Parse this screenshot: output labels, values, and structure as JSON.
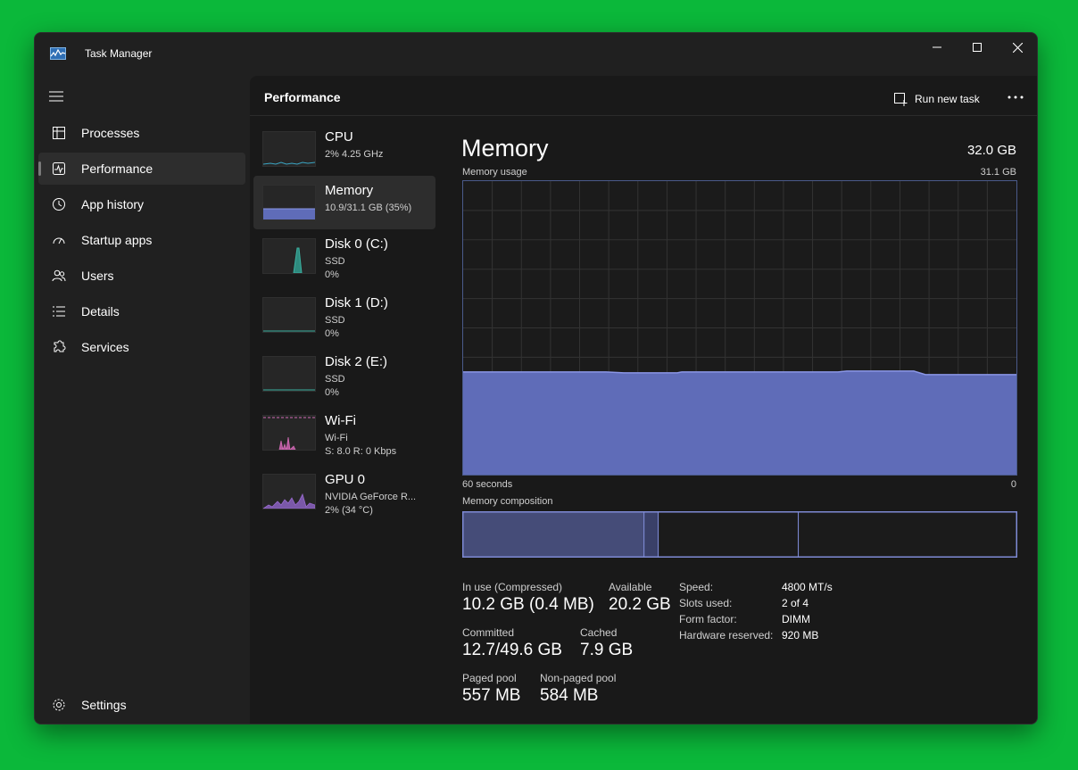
{
  "window": {
    "title": "Task Manager",
    "icon": "task-manager-icon"
  },
  "nav": {
    "items": [
      {
        "label": "Processes",
        "icon": "processes-icon",
        "active": false
      },
      {
        "label": "Performance",
        "icon": "performance-icon",
        "active": true
      },
      {
        "label": "App history",
        "icon": "app-history-icon",
        "active": false
      },
      {
        "label": "Startup apps",
        "icon": "startup-apps-icon",
        "active": false
      },
      {
        "label": "Users",
        "icon": "users-icon",
        "active": false
      },
      {
        "label": "Details",
        "icon": "details-icon",
        "active": false
      },
      {
        "label": "Services",
        "icon": "services-icon",
        "active": false
      }
    ],
    "settings_label": "Settings"
  },
  "header": {
    "title": "Performance",
    "run_new_task": "Run new task"
  },
  "resources": [
    {
      "name": "CPU",
      "line1": "2% 4.25 GHz",
      "line2": "",
      "color": "#3aa6c4"
    },
    {
      "name": "Memory",
      "line1": "10.9/31.1 GB (35%)",
      "line2": "",
      "color": "#6b7fd8"
    },
    {
      "name": "Disk 0 (C:)",
      "line1": "SSD",
      "line2": "0%",
      "color": "#3bb0a0"
    },
    {
      "name": "Disk 1 (D:)",
      "line1": "SSD",
      "line2": "0%",
      "color": "#3bb0a0"
    },
    {
      "name": "Disk 2 (E:)",
      "line1": "SSD",
      "line2": "0%",
      "color": "#3bb0a0"
    },
    {
      "name": "Wi-Fi",
      "line1": "Wi-Fi",
      "line2": "S: 8.0 R: 0 Kbps",
      "color": "#d06ab4"
    },
    {
      "name": "GPU 0",
      "line1": "NVIDIA GeForce R...",
      "line2": "2% (34 °C)",
      "color": "#9a6ad0"
    }
  ],
  "memory": {
    "title": "Memory",
    "total": "32.0 GB",
    "usage_label": "Memory usage",
    "usage_max": "31.1 GB",
    "time_left": "60 seconds",
    "time_right": "0",
    "composition_label": "Memory composition",
    "composition": {
      "in_use": 10.2,
      "modified": 0.4,
      "standby": 7.9,
      "free": 12.3
    },
    "usage_fraction": 0.35,
    "stats": {
      "in_use_label": "In use (Compressed)",
      "in_use_value": "10.2 GB (0.4 MB)",
      "available_label": "Available",
      "available_value": "20.2 GB",
      "committed_label": "Committed",
      "committed_value": "12.7/49.6 GB",
      "cached_label": "Cached",
      "cached_value": "7.9 GB",
      "paged_label": "Paged pool",
      "paged_value": "557 MB",
      "nonpaged_label": "Non-paged pool",
      "nonpaged_value": "584 MB"
    },
    "specs": [
      {
        "key": "Speed:",
        "value": "4800 MT/s"
      },
      {
        "key": "Slots used:",
        "value": "2 of 4"
      },
      {
        "key": "Form factor:",
        "value": "DIMM"
      },
      {
        "key": "Hardware reserved:",
        "value": "920 MB"
      }
    ]
  },
  "colors": {
    "memory_fill": "#5f6cb8",
    "memory_line": "#8a96e6",
    "accent": "#7a7a7a"
  }
}
